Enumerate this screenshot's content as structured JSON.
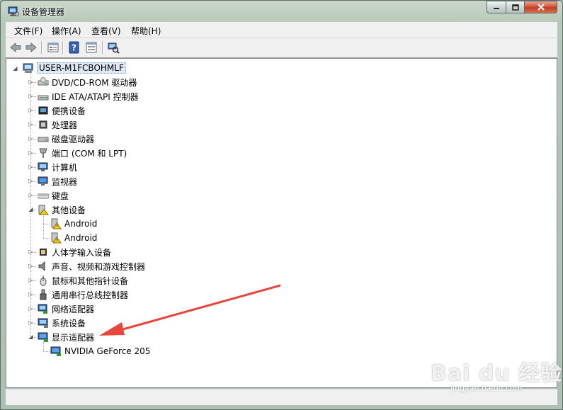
{
  "window": {
    "title": "设备管理器"
  },
  "menu": [
    {
      "label": "文件(F)"
    },
    {
      "label": "操作(A)"
    },
    {
      "label": "查看(V)"
    },
    {
      "label": "帮助(H)"
    }
  ],
  "toolbar": {
    "icons": [
      "back-arrow-icon",
      "forward-arrow-icon",
      "properties-icon",
      "help-icon",
      "view-icon",
      "scan-hardware-icon"
    ]
  },
  "tree": {
    "root": "USER-M1FCBOHMLF",
    "items": [
      {
        "label": "DVD/CD-ROM 驱动器",
        "icon": "dvd-drive-icon",
        "expanded": false
      },
      {
        "label": "IDE ATA/ATAPI 控制器",
        "icon": "ide-controller-icon",
        "expanded": false
      },
      {
        "label": "便携设备",
        "icon": "portable-device-icon",
        "expanded": false
      },
      {
        "label": "处理器",
        "icon": "processor-icon",
        "expanded": false
      },
      {
        "label": "磁盘驱动器",
        "icon": "disk-drive-icon",
        "expanded": false
      },
      {
        "label": "端口 (COM 和 LPT)",
        "icon": "port-icon",
        "expanded": false
      },
      {
        "label": "计算机",
        "icon": "computer-icon",
        "expanded": false
      },
      {
        "label": "监视器",
        "icon": "monitor-icon",
        "expanded": false
      },
      {
        "label": "键盘",
        "icon": "keyboard-icon",
        "expanded": false
      },
      {
        "label": "其他设备",
        "icon": "other-devices-icon",
        "expanded": true,
        "children": [
          {
            "label": "Android",
            "icon": "warning-device-icon"
          },
          {
            "label": "Android",
            "icon": "warning-device-icon"
          }
        ]
      },
      {
        "label": "人体学输入设备",
        "icon": "hid-icon",
        "expanded": false
      },
      {
        "label": "声音、视频和游戏控制器",
        "icon": "sound-icon",
        "expanded": false
      },
      {
        "label": "鼠标和其他指针设备",
        "icon": "mouse-icon",
        "expanded": false
      },
      {
        "label": "通用串行总线控制器",
        "icon": "usb-icon",
        "expanded": false
      },
      {
        "label": "网络适配器",
        "icon": "network-adapter-icon",
        "expanded": false
      },
      {
        "label": "系统设备",
        "icon": "system-device-icon",
        "expanded": false
      },
      {
        "label": "显示适配器",
        "icon": "display-adapter-icon",
        "expanded": true,
        "children": [
          {
            "label": "NVIDIA GeForce 205",
            "icon": "display-adapter-icon"
          }
        ]
      }
    ]
  },
  "watermark": {
    "main": "Bai du 经验",
    "sub": "jingyan.baidu.com"
  },
  "colors": {
    "annotation_arrow": "#e8453c",
    "selection": "#dfe9f5"
  }
}
